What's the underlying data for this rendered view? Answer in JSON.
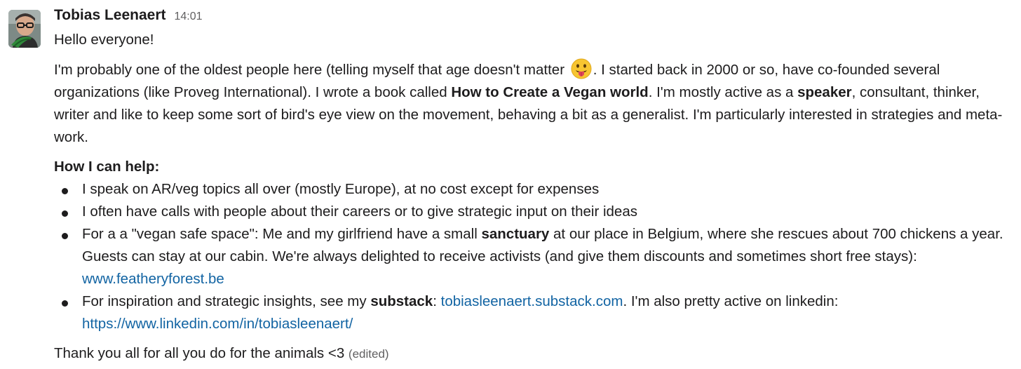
{
  "message": {
    "author": "Tobias Leenaert",
    "timestamp": "14:01",
    "greeting": "Hello everyone!",
    "intro": {
      "t1": "I'm probably one of the oldest people here (telling myself that age doesn't matter ",
      "emoji": "face-with-tongue-emoji",
      "t2": ". I started back in 2000 or so, have co-founded several organizations (like Proveg International). I wrote a book called ",
      "book_title": "How to Create a Vegan world",
      "t3": ". I'm mostly active as a ",
      "speaker": "speaker",
      "t4": ", consultant, thinker, writer and like to keep some sort of bird's eye view on the movement, behaving a bit as a generalist. I'm particularly interested in strategies and meta-work."
    },
    "help_title": "How I can help:",
    "bullets": {
      "b1": "I speak on AR/veg topics all over (mostly Europe), at no cost except for expenses",
      "b2": "I often have calls with people about their careers or to give strategic input on their ideas",
      "b3": {
        "t1": "For a a \"vegan safe space\": Me and my girlfriend have a small ",
        "bold": "sanctuary",
        "t2": " at our place in Belgium, where she rescues about 700 chickens a year. Guests can stay at our cabin. We're always delighted to receive activists (and give them discounts and sometimes short free stays): ",
        "link": "www.featheryforest.be"
      },
      "b4": {
        "t1": "For inspiration and strategic insights, see my ",
        "bold": "substack",
        "t2": ": ",
        "link1": "tobiasleenaert.substack.com",
        "t3": ". I'm also pretty active on linkedin: ",
        "link2": "https://www.linkedin.com/in/tobiasleenaert/"
      }
    },
    "closing": "Thank you all for all you do for the animals <3",
    "edited": "(edited)",
    "colors": {
      "text": "#1d1c1d",
      "link": "#1264a3",
      "muted": "#616061"
    }
  }
}
